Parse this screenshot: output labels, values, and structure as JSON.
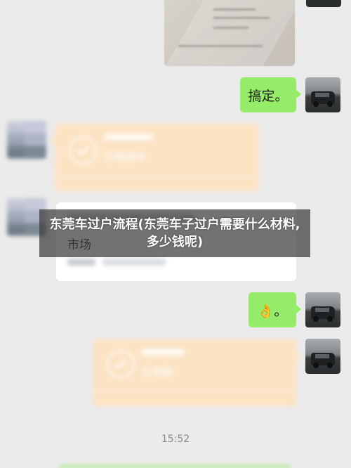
{
  "overlay": {
    "title": "东莞车过户流程(东莞车子过户需要什么材料,多少钱呢)"
  },
  "chat": {
    "msg_done": "搞定。",
    "msg_emoji": "👌。",
    "transfer_received": "已被接收",
    "location_text": "市场",
    "transfer_collected": "已收款",
    "timestamp": "15:52"
  },
  "colors": {
    "background": "#ebebeb",
    "green_bubble": "#95ec69",
    "transfer_card": "#fbe3c4"
  },
  "icons": {
    "check": "check-circle-icon"
  }
}
